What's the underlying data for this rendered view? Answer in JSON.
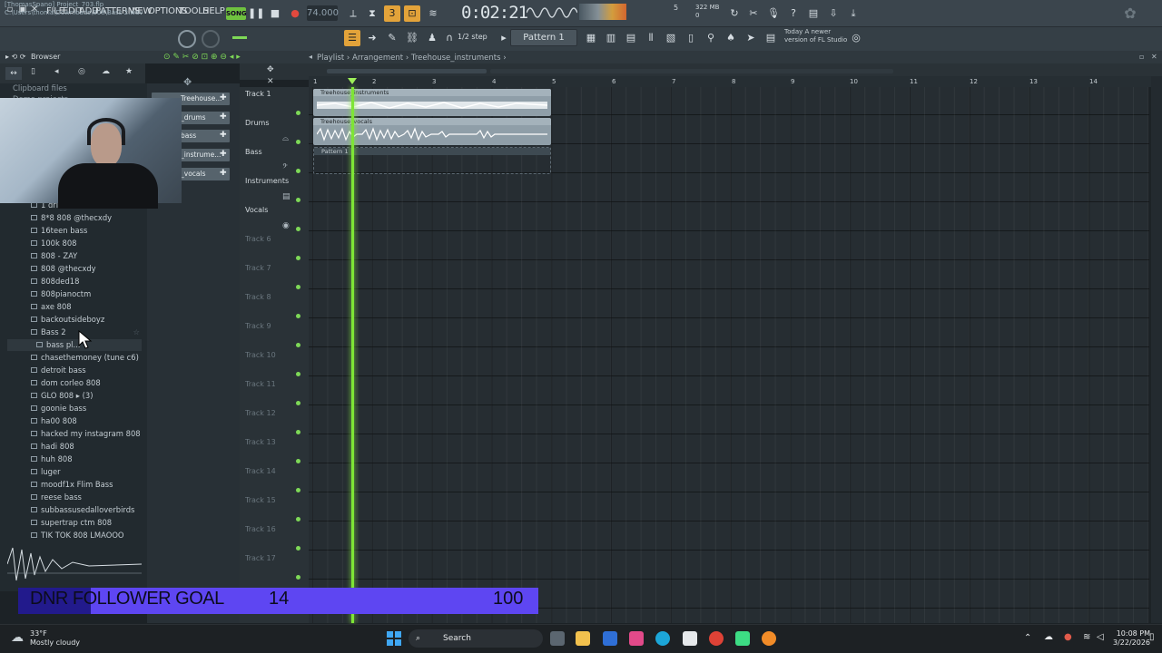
{
  "menu": [
    "FILE",
    "EDIT",
    "ADD",
    "PATTERNS",
    "VIEW",
    "OPTIONS",
    "TOOLS",
    "HELP"
  ],
  "transport": {
    "mode": "SONG",
    "tempo": "74.000",
    "time": "0:02:21",
    "time_ms": "",
    "cpu": "5",
    "memory": "322 MB",
    "memory2": "0"
  },
  "project": {
    "title": "[ThomasSpano] Project_703.flp",
    "path": "C:\\Users\\thoma\\Downloads\\808\\Bass 2.wav"
  },
  "toolbar2": {
    "step": "1/2 step",
    "pattern": "Pattern 1",
    "newver_line1": "Today  A newer",
    "newver_line2": "version of FL Studio"
  },
  "browser": {
    "title": "Browser",
    "top_items": [
      "Clipboard files",
      "Demo projects"
    ],
    "items": [
      "1 drill 808",
      "8*8 808 @thecxdy",
      "16teen bass",
      "100k 808",
      "808 - ZAY",
      "808 @thecxdy",
      "808ded18",
      "808pianoctm",
      "axe 808",
      "backoutsideboyz",
      "Bass 2",
      "bass pl...",
      "chasethemoney (tune c6)",
      "detroit bass",
      "dom corleo 808",
      "GLO 808 ▸ (3)",
      "goonie bass",
      "ha00 808",
      "hacked my instagram 808",
      "hadi 808",
      "huh 808",
      "luger",
      "moodf1x  Flim Bass",
      "reese bass",
      "subbassusedalloverbirds",
      "supertrap ctm 808",
      "TIK TOK 808 LMAOOO"
    ]
  },
  "channels": [
    "Treehouse...",
    "_drums",
    "bass",
    "_instrume...",
    "_vocals"
  ],
  "playlist": {
    "breadcrumb": "Playlist › Arrangement › Treehouse_instruments ›",
    "ruler": [
      "1",
      "2",
      "3",
      "4",
      "5",
      "6",
      "7",
      "8",
      "9",
      "10",
      "11",
      "12",
      "13",
      "14"
    ],
    "tracks": [
      "Track 1",
      "Drums",
      "Bass",
      "Instruments",
      "Vocals",
      "Track 6",
      "Track 7",
      "Track 8",
      "Track 9",
      "Track 10",
      "Track 11",
      "Track 12",
      "Track 13",
      "Track 14",
      "Track 15",
      "Track 16",
      "Track 17"
    ],
    "clips": {
      "instruments": "Treehouse_instruments",
      "vocals": "Treehouse_vocals",
      "pattern": "Pattern 1"
    },
    "playhead_bar": 1.7
  },
  "goal": {
    "title": "DNR FOLLOWER GOAL",
    "current": "14",
    "target": "100",
    "progress": 0.14
  },
  "taskbar": {
    "weather_temp": "33°F",
    "weather_desc": "Mostly cloudy",
    "search": "Search",
    "time": "10:08 PM",
    "date": "3/22/2026"
  },
  "colors": {
    "accent_green": "#7ee536",
    "goal_bar": "#5e46f2",
    "clip": "#8f9ea8"
  }
}
